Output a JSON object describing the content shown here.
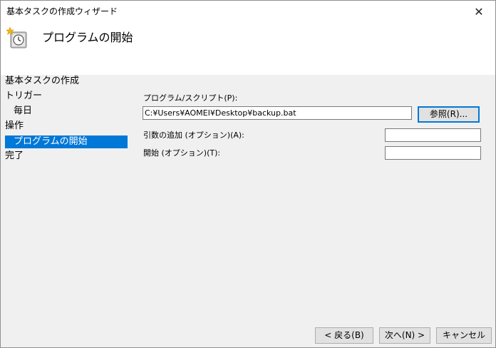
{
  "window": {
    "title": "基本タスクの作成ウィザード",
    "close_glyph": "✕"
  },
  "header": {
    "title": "プログラムの開始",
    "icon": "task-scheduler-clock-icon"
  },
  "sidebar": {
    "items": [
      {
        "label": "基本タスクの作成"
      },
      {
        "label": "トリガー"
      },
      {
        "label": "毎日"
      },
      {
        "label": "操作"
      },
      {
        "label": "プログラムの開始"
      },
      {
        "label": "完了"
      }
    ],
    "selected_index": 4
  },
  "form": {
    "program_label": "プログラム/スクリプト(P):",
    "program_value": "C:¥Users¥AOMEI¥Desktop¥backup.bat",
    "browse_label": "参照(R)...",
    "args_label": "引数の追加 (オプション)(A):",
    "args_value": "",
    "start_label": "開始 (オプション)(T):",
    "start_value": ""
  },
  "footer": {
    "back_label": "< 戻る(B)",
    "next_label": "次へ(N) >",
    "cancel_label": "キャンセル"
  },
  "colors": {
    "accent": "#0078d7",
    "panel": "#f0f0f0"
  }
}
